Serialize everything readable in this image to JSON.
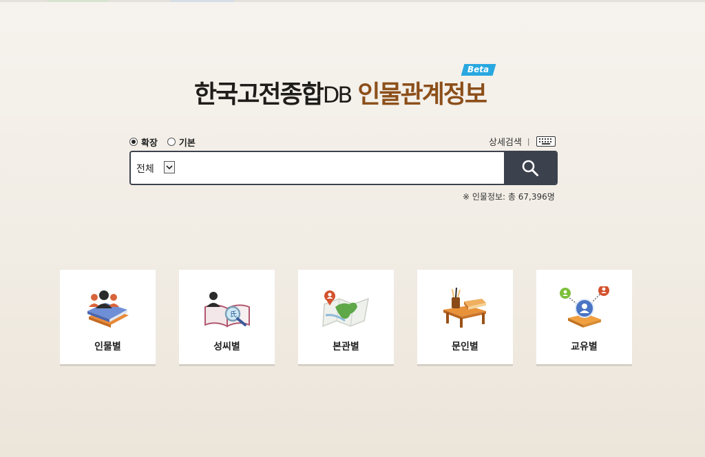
{
  "header": {
    "title_main": "한국고전종합",
    "title_db": "DB",
    "title_sub": "인물관계정보",
    "beta_badge": "Beta"
  },
  "search_options": {
    "modes": [
      {
        "label": "확장",
        "checked": true
      },
      {
        "label": "기본",
        "checked": false
      }
    ],
    "advanced_search_label": "상세검색",
    "separator": "|",
    "keyboard_icon": "keyboard-icon"
  },
  "search": {
    "scope_value": "전체",
    "query_value": "",
    "button_icon": "search-icon"
  },
  "stats": {
    "count_text": "※ 인물정보: 총 67,396명"
  },
  "categories": [
    {
      "label": "인물별",
      "icon": "people-books-icon"
    },
    {
      "label": "성씨별",
      "icon": "surname-book-icon"
    },
    {
      "label": "본관별",
      "icon": "map-pin-icon"
    },
    {
      "label": "문인별",
      "icon": "desk-brushes-icon"
    },
    {
      "label": "교유별",
      "icon": "network-people-icon"
    }
  ],
  "colors": {
    "title_dark": "#1f1d1a",
    "title_accent": "#8c4f1a",
    "beta_blue": "#29a8e0",
    "search_button": "#3b414d"
  }
}
